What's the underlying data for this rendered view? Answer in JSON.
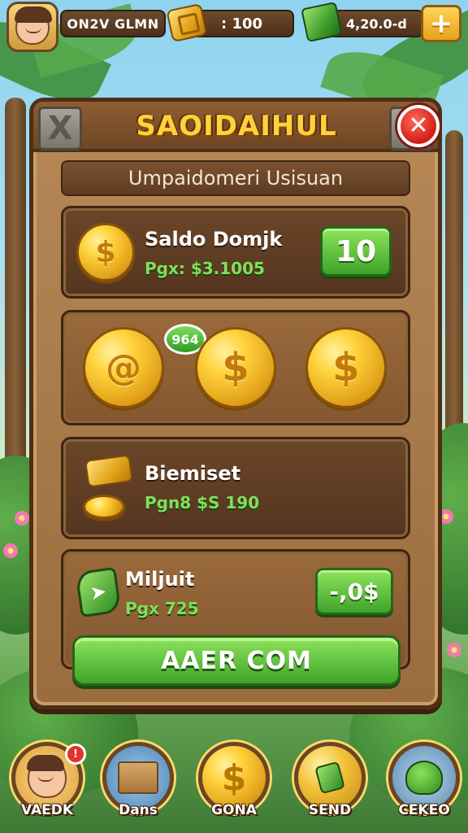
{
  "topbar": {
    "player_name": "ON2V GLMN",
    "coins_value": ": 100",
    "cash_value": "4,20.0-d",
    "plus_label": "+"
  },
  "panel": {
    "title": "SAOIDAIHUL",
    "subtitle": "Umpaidomeri Usisuan",
    "close_label": "✕",
    "corner_label": "X",
    "rows": {
      "saldo": {
        "title": "Saldo Domjk",
        "sub": "Pgx: $3.1005",
        "button": "10",
        "coin_symbol": "$"
      },
      "coins": {
        "badge": "964",
        "coin_symbols": [
          "@",
          "$",
          "$"
        ]
      },
      "bonus": {
        "title": "Biemiset",
        "sub": "Pgn8 $S 190"
      },
      "multi": {
        "title": "Miljuit",
        "sub": "Pgx 725",
        "button": "-,0$"
      }
    },
    "cta_label": "AAER COM"
  },
  "nav": {
    "items": [
      {
        "label": "VAEDK",
        "icon": "avatar-icon",
        "badge": "!"
      },
      {
        "label": "Dans",
        "icon": "box-icon"
      },
      {
        "label": "GONA",
        "icon": "coin-icon",
        "symbol": "$"
      },
      {
        "label": "SEND",
        "icon": "send-icon"
      },
      {
        "label": "CEKEO",
        "icon": "frog-icon"
      }
    ]
  },
  "colors": {
    "accent_gold": "#ffd23a",
    "accent_green": "#3fa42a",
    "panel_wood": "#9a6c3e",
    "close_red": "#d11d14"
  }
}
